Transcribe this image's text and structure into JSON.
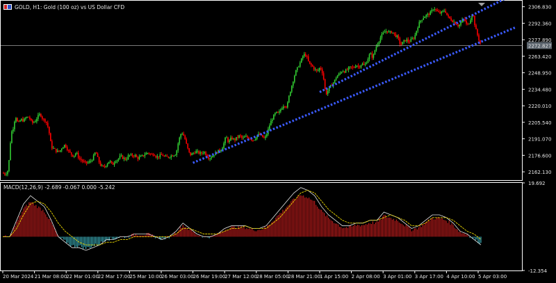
{
  "window": {
    "symbol_title": "GOLD, H1:  Gold (100 oz) vs US Dollar CFD",
    "indicator_title": "MACD(12,26,9) -2.689 -0.067 0.000 -5.242",
    "current_price_label": "2272.827"
  },
  "colors": {
    "background": "#000000",
    "frame": "#ffffff",
    "bull_candle": "#32cd32",
    "bear_candle": "#ff0000",
    "trendline": "#3b5bff",
    "price_line": "#a0a0a0",
    "histogram_pos": "#d92020",
    "histogram_neg": "#43c3d0",
    "macd_line": "#e8e8e8",
    "signal_line": "#e8d400",
    "price_label_bg": "#5e6770"
  },
  "chart_data": [
    {
      "type": "candlestick",
      "title": "GOLD, H1:  Gold (100 oz) vs US Dollar CFD",
      "ylim": [
        2155.5,
        2311.5
      ],
      "y_ticks": [
        "2306.830",
        "2292.360",
        "2277.890",
        "2263.420",
        "2248.950",
        "2234.480",
        "2220.010",
        "2205.540",
        "2191.070",
        "2176.600",
        "2162.130"
      ],
      "x_ticks": [
        "20 Mar 2024",
        "21 Mar 08:00",
        "22 Mar 01:00",
        "22 Mar 17:00",
        "25 Mar 10:00",
        "26 Mar 03:00",
        "26 Mar 19:00",
        "27 Mar 12:00",
        "28 Mar 05:00",
        "28 Mar 21:00",
        "1 Apr 15:00",
        "2 Apr 08:00",
        "3 Apr 01:00",
        "3 Apr 17:00",
        "4 Apr 10:00",
        "5 Apr 03:00"
      ],
      "close_path": [
        [
          0,
          2161
        ],
        [
          4,
          2160
        ],
        [
          8,
          2164
        ],
        [
          12,
          2196
        ],
        [
          16,
          2202
        ],
        [
          18,
          2212
        ],
        [
          22,
          2204
        ],
        [
          26,
          2208
        ],
        [
          30,
          2207
        ],
        [
          34,
          2210
        ],
        [
          38,
          2210
        ],
        [
          42,
          2205
        ],
        [
          46,
          2206
        ],
        [
          50,
          2210
        ],
        [
          54,
          2213
        ],
        [
          58,
          2208
        ],
        [
          62,
          2207
        ],
        [
          66,
          2200
        ],
        [
          70,
          2184
        ],
        [
          74,
          2182
        ],
        [
          78,
          2180
        ],
        [
          82,
          2180
        ],
        [
          86,
          2184
        ],
        [
          90,
          2186
        ],
        [
          94,
          2181
        ],
        [
          98,
          2178
        ],
        [
          102,
          2176
        ],
        [
          106,
          2179
        ],
        [
          110,
          2174
        ],
        [
          114,
          2172
        ],
        [
          118,
          2170
        ],
        [
          122,
          2170
        ],
        [
          126,
          2171
        ],
        [
          130,
          2174
        ],
        [
          134,
          2180
        ],
        [
          138,
          2172
        ],
        [
          142,
          2167
        ],
        [
          146,
          2166
        ],
        [
          150,
          2169
        ],
        [
          154,
          2172
        ],
        [
          158,
          2168
        ],
        [
          162,
          2172
        ],
        [
          166,
          2173
        ],
        [
          170,
          2176
        ],
        [
          174,
          2174
        ],
        [
          178,
          2173
        ],
        [
          182,
          2177
        ],
        [
          186,
          2176
        ],
        [
          190,
          2177
        ],
        [
          194,
          2174
        ],
        [
          198,
          2175
        ],
        [
          202,
          2176
        ],
        [
          206,
          2178
        ],
        [
          210,
          2179
        ],
        [
          214,
          2177
        ],
        [
          218,
          2178
        ],
        [
          222,
          2175
        ],
        [
          226,
          2176
        ],
        [
          230,
          2177
        ],
        [
          234,
          2175
        ],
        [
          238,
          2175
        ],
        [
          242,
          2176
        ],
        [
          246,
          2177
        ],
        [
          250,
          2178
        ],
        [
          254,
          2190
        ],
        [
          258,
          2197
        ],
        [
          262,
          2193
        ],
        [
          266,
          2184
        ],
        [
          270,
          2177
        ],
        [
          274,
          2178
        ],
        [
          278,
          2180
        ],
        [
          282,
          2179
        ],
        [
          286,
          2178
        ],
        [
          290,
          2180
        ],
        [
          294,
          2177
        ],
        [
          298,
          2174
        ],
        [
          302,
          2176
        ],
        [
          306,
          2178
        ],
        [
          310,
          2180
        ],
        [
          314,
          2181
        ],
        [
          318,
          2185
        ],
        [
          322,
          2193
        ],
        [
          326,
          2188
        ],
        [
          330,
          2192
        ],
        [
          334,
          2190
        ],
        [
          338,
          2192
        ],
        [
          342,
          2194
        ],
        [
          346,
          2191
        ],
        [
          350,
          2193
        ],
        [
          354,
          2192
        ],
        [
          358,
          2191
        ],
        [
          362,
          2190
        ],
        [
          366,
          2193
        ],
        [
          370,
          2195
        ],
        [
          374,
          2193
        ],
        [
          378,
          2191
        ],
        [
          382,
          2197
        ],
        [
          386,
          2205
        ],
        [
          390,
          2210
        ],
        [
          394,
          2214
        ],
        [
          398,
          2213
        ],
        [
          402,
          2218
        ],
        [
          406,
          2221
        ],
        [
          410,
          2219
        ],
        [
          414,
          2231
        ],
        [
          418,
          2240
        ],
        [
          422,
          2249
        ],
        [
          426,
          2254
        ],
        [
          430,
          2259
        ],
        [
          434,
          2265
        ],
        [
          438,
          2264
        ],
        [
          442,
          2257
        ],
        [
          446,
          2255
        ],
        [
          450,
          2252
        ],
        [
          454,
          2250
        ],
        [
          458,
          2254
        ],
        [
          462,
          2248
        ],
        [
          466,
          2230
        ],
        [
          470,
          2234
        ],
        [
          474,
          2238
        ],
        [
          478,
          2241
        ],
        [
          482,
          2246
        ],
        [
          486,
          2248
        ],
        [
          490,
          2251
        ],
        [
          494,
          2250
        ],
        [
          498,
          2252
        ],
        [
          502,
          2254
        ],
        [
          506,
          2253
        ],
        [
          510,
          2256
        ],
        [
          514,
          2254
        ],
        [
          518,
          2257
        ],
        [
          522,
          2255
        ],
        [
          526,
          2260
        ],
        [
          530,
          2266
        ],
        [
          534,
          2262
        ],
        [
          538,
          2271
        ],
        [
          542,
          2276
        ],
        [
          546,
          2281
        ],
        [
          550,
          2284
        ],
        [
          554,
          2286
        ],
        [
          558,
          2284
        ],
        [
          562,
          2285
        ],
        [
          566,
          2282
        ],
        [
          570,
          2280
        ],
        [
          574,
          2273
        ],
        [
          578,
          2276
        ],
        [
          582,
          2278
        ],
        [
          586,
          2276
        ],
        [
          590,
          2278
        ],
        [
          594,
          2280
        ],
        [
          598,
          2288
        ],
        [
          602,
          2294
        ],
        [
          606,
          2297
        ],
        [
          610,
          2299
        ],
        [
          614,
          2300
        ],
        [
          618,
          2302
        ],
        [
          622,
          2306
        ],
        [
          626,
          2303
        ],
        [
          630,
          2301
        ],
        [
          634,
          2302
        ],
        [
          638,
          2304
        ],
        [
          642,
          2298
        ],
        [
          646,
          2296
        ],
        [
          650,
          2294
        ],
        [
          654,
          2292
        ],
        [
          658,
          2290
        ],
        [
          662,
          2294
        ],
        [
          666,
          2296
        ],
        [
          670,
          2290
        ],
        [
          674,
          2294
        ],
        [
          678,
          2302
        ],
        [
          682,
          2288
        ],
        [
          686,
          2280
        ],
        [
          690,
          2272.8
        ]
      ],
      "trendlines": [
        {
          "from": [
            "1 Apr 15:00",
            2232
          ],
          "to": [
            "5 Apr 03:00",
            2302
          ]
        },
        {
          "from": [
            "26 Mar 19:00",
            2170
          ],
          "to": [
            "5 Apr 03:00",
            2275
          ]
        }
      ],
      "current_price": 2272.827
    },
    {
      "type": "macd",
      "title": "MACD(12,26,9) -2.689 -0.067 0.000 -5.242",
      "params": [
        12,
        26,
        9
      ],
      "values": {
        "macd": -2.689,
        "signal": -0.067,
        "histogram": 0.0,
        "extra": -5.242
      },
      "ylim": [
        -12.354,
        19.692
      ],
      "y_ticks": [
        "19.692",
        "-12.354"
      ],
      "macd_line": [
        [
          0,
          0
        ],
        [
          10,
          0
        ],
        [
          20,
          6
        ],
        [
          30,
          12
        ],
        [
          40,
          15
        ],
        [
          50,
          13
        ],
        [
          60,
          11
        ],
        [
          70,
          6
        ],
        [
          80,
          0
        ],
        [
          90,
          -2
        ],
        [
          100,
          -4
        ],
        [
          110,
          -4
        ],
        [
          120,
          -5
        ],
        [
          130,
          -4
        ],
        [
          140,
          -3
        ],
        [
          150,
          -1
        ],
        [
          160,
          -1
        ],
        [
          170,
          0
        ],
        [
          180,
          0
        ],
        [
          190,
          1
        ],
        [
          200,
          1
        ],
        [
          210,
          1
        ],
        [
          220,
          0
        ],
        [
          230,
          -1
        ],
        [
          240,
          0
        ],
        [
          250,
          2
        ],
        [
          260,
          5
        ],
        [
          270,
          3
        ],
        [
          280,
          1
        ],
        [
          290,
          0
        ],
        [
          300,
          0
        ],
        [
          310,
          1
        ],
        [
          320,
          3
        ],
        [
          330,
          4
        ],
        [
          340,
          4
        ],
        [
          350,
          4
        ],
        [
          360,
          3
        ],
        [
          370,
          3
        ],
        [
          380,
          4
        ],
        [
          390,
          7
        ],
        [
          400,
          10
        ],
        [
          410,
          13
        ],
        [
          420,
          16
        ],
        [
          430,
          18
        ],
        [
          440,
          17
        ],
        [
          450,
          15
        ],
        [
          460,
          11
        ],
        [
          470,
          8
        ],
        [
          480,
          6
        ],
        [
          490,
          4
        ],
        [
          500,
          4
        ],
        [
          510,
          5
        ],
        [
          520,
          5
        ],
        [
          530,
          6
        ],
        [
          540,
          6
        ],
        [
          550,
          9
        ],
        [
          560,
          8
        ],
        [
          570,
          7
        ],
        [
          580,
          5
        ],
        [
          590,
          3
        ],
        [
          600,
          4
        ],
        [
          610,
          6
        ],
        [
          620,
          8
        ],
        [
          630,
          8
        ],
        [
          640,
          7
        ],
        [
          650,
          5
        ],
        [
          660,
          2
        ],
        [
          670,
          1
        ],
        [
          680,
          -1
        ],
        [
          690,
          -3
        ]
      ],
      "signal_line": [
        [
          0,
          0
        ],
        [
          10,
          0
        ],
        [
          20,
          3
        ],
        [
          30,
          8
        ],
        [
          40,
          12
        ],
        [
          50,
          13
        ],
        [
          60,
          12
        ],
        [
          70,
          9
        ],
        [
          80,
          5
        ],
        [
          90,
          2
        ],
        [
          100,
          0
        ],
        [
          110,
          -2
        ],
        [
          120,
          -3
        ],
        [
          130,
          -3
        ],
        [
          140,
          -3
        ],
        [
          150,
          -2
        ],
        [
          160,
          -2
        ],
        [
          170,
          -1
        ],
        [
          180,
          -1
        ],
        [
          190,
          0
        ],
        [
          200,
          0
        ],
        [
          210,
          0
        ],
        [
          220,
          0
        ],
        [
          230,
          0
        ],
        [
          240,
          0
        ],
        [
          250,
          1
        ],
        [
          260,
          3
        ],
        [
          270,
          3
        ],
        [
          280,
          2
        ],
        [
          290,
          1
        ],
        [
          300,
          1
        ],
        [
          310,
          1
        ],
        [
          320,
          2
        ],
        [
          330,
          3
        ],
        [
          340,
          3
        ],
        [
          350,
          4
        ],
        [
          360,
          3
        ],
        [
          370,
          3
        ],
        [
          380,
          3
        ],
        [
          390,
          5
        ],
        [
          400,
          7
        ],
        [
          410,
          10
        ],
        [
          420,
          13
        ],
        [
          430,
          16
        ],
        [
          440,
          17
        ],
        [
          450,
          16
        ],
        [
          460,
          13
        ],
        [
          470,
          10
        ],
        [
          480,
          8
        ],
        [
          490,
          6
        ],
        [
          500,
          5
        ],
        [
          510,
          5
        ],
        [
          520,
          5
        ],
        [
          530,
          6
        ],
        [
          540,
          6
        ],
        [
          550,
          7
        ],
        [
          560,
          8
        ],
        [
          570,
          7
        ],
        [
          580,
          6
        ],
        [
          590,
          4
        ],
        [
          600,
          4
        ],
        [
          610,
          5
        ],
        [
          620,
          7
        ],
        [
          630,
          7
        ],
        [
          640,
          7
        ],
        [
          650,
          6
        ],
        [
          660,
          4
        ],
        [
          670,
          2
        ],
        [
          680,
          1
        ],
        [
          690,
          -1
        ]
      ]
    }
  ]
}
